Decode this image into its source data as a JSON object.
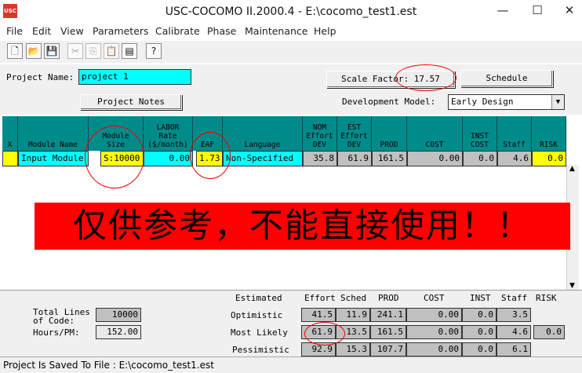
{
  "window": {
    "title": "USC-COCOMO II.2000.4 - E:\\cocomo_test1.est",
    "icon_text": "USC",
    "min": "—",
    "max": "☐",
    "close": "✕"
  },
  "menu": [
    "File",
    "Edit",
    "View",
    "Parameters",
    "Calibrate",
    "Phase",
    "Maintenance",
    "Help"
  ],
  "toolbar": {
    "icons": [
      "new-file-icon",
      "open-folder-icon",
      "save-icon",
      "cut-icon",
      "copy-icon",
      "paste-icon",
      "add-module-icon",
      "help-icon"
    ],
    "glyphs": [
      "🗋",
      "📂",
      "💾",
      "✂",
      "⎘",
      "📋",
      "▤",
      "?"
    ]
  },
  "project": {
    "name_label": "Project Name:",
    "name_value": "project 1",
    "notes_button": "Project Notes",
    "scale_factor_label": "Scale Factor:",
    "scale_factor_value": "17.57",
    "schedule_button": "Schedule",
    "dev_model_label": "Development Model:",
    "dev_model_value": "Early Design"
  },
  "grid": {
    "headers": {
      "x": "X",
      "module_name": "Module Name",
      "module_size": "Module\nSize",
      "labor_rate": "LABOR\nRate\n($/month)",
      "eaf": "EAF",
      "language": "Language",
      "nom_effort": "NOM\nEffort\nDEV",
      "est_effort": "EST\nEffort\nDEV",
      "prod": "PROD",
      "cost": "COST",
      "inst_cost": "INST\nCOST",
      "staff": "Staff",
      "risk": "RISK"
    },
    "row": {
      "x": "",
      "module_name": "Input Module",
      "module_size": "S:10000",
      "labor_rate": "0.00",
      "eaf": "1.73",
      "language": "Non-Specified",
      "nom_effort": "35.8",
      "est_effort": "61.9",
      "prod": "161.5",
      "cost": "0.00",
      "inst_cost": "0.0",
      "staff": "4.6",
      "risk": "0.0"
    }
  },
  "banner": {
    "text": "仅供参考，不能直接使用！！",
    "color": "#ff0000"
  },
  "summary": {
    "total_lines_label": "Total Lines\nof Code:",
    "total_lines_value": "10000",
    "hours_pm_label": "Hours/PM:",
    "hours_pm_value": "152.00",
    "estimated_label": "Estimated",
    "columns": [
      "Effort",
      "Sched",
      "PROD",
      "COST",
      "INST",
      "Staff",
      "RISK"
    ],
    "rows": [
      {
        "label": "Optimistic",
        "effort": "41.5",
        "sched": "11.9",
        "prod": "241.1",
        "cost": "0.00",
        "inst": "0.0",
        "staff": "3.5",
        "risk": ""
      },
      {
        "label": "Most Likely",
        "effort": "61.9",
        "sched": "13.5",
        "prod": "161.5",
        "cost": "0.00",
        "inst": "0.0",
        "staff": "4.6",
        "risk": "0.0"
      },
      {
        "label": "Pessimistic",
        "effort": "92.9",
        "sched": "15.3",
        "prod": "107.7",
        "cost": "0.00",
        "inst": "0.0",
        "staff": "6.1",
        "risk": ""
      }
    ]
  },
  "status": {
    "text": "Project Is Saved To File : E:\\cocomo_test1.est"
  },
  "colors": {
    "grid_header": "#008b8b",
    "highlight_cyan": "#00ffff",
    "highlight_yellow": "#ffff00",
    "annotation_red": "#e00000"
  }
}
